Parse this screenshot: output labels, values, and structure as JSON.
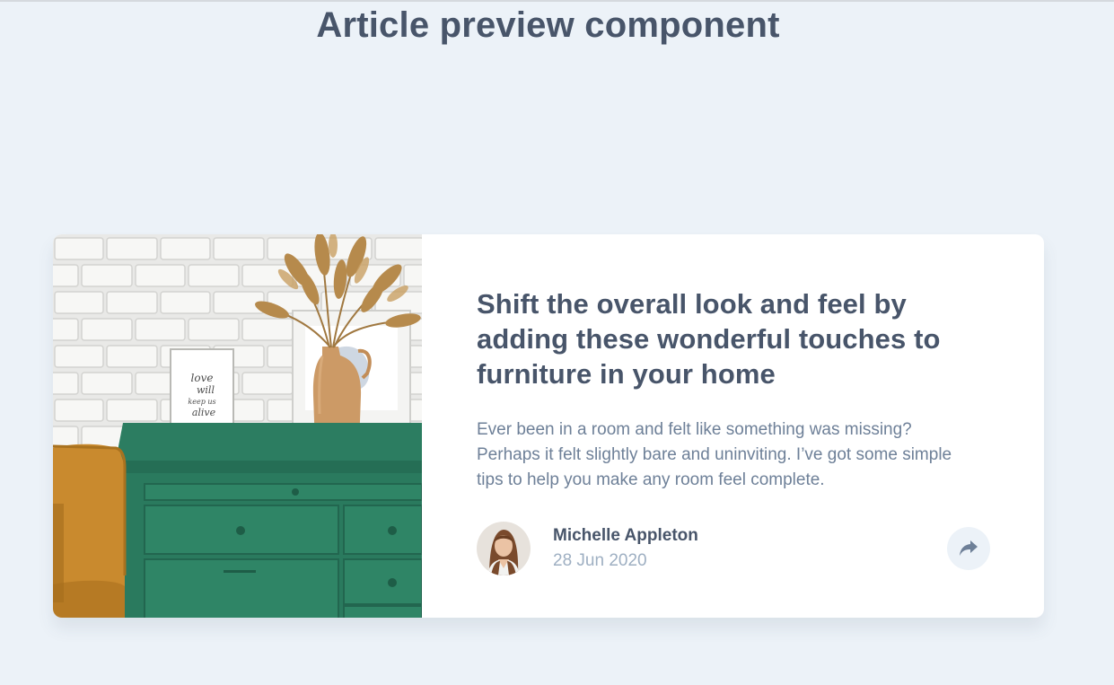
{
  "page": {
    "title": "Article preview component"
  },
  "article": {
    "image_alt": "Green drawers with a framed picture and a vase of dried grass",
    "frame_text": "love will keep us alive",
    "headline": "Shift the overall look and feel by adding these wonderful touches to furniture in your home",
    "excerpt": "Ever been in a room and felt like something was missing? Perhaps it felt slightly bare and uninviting. I’ve got some simple tips to help you make any room feel complete.",
    "author": {
      "name": "Michelle Appleton",
      "date": "28 Jun 2020"
    },
    "share": {
      "icon": "share-icon",
      "label": "Share"
    }
  },
  "colors": {
    "background": "#ECF2F8",
    "heading": "#48556A",
    "body": "#6E8098",
    "muted": "#9EAFC2",
    "card": "#FFFFFF"
  }
}
